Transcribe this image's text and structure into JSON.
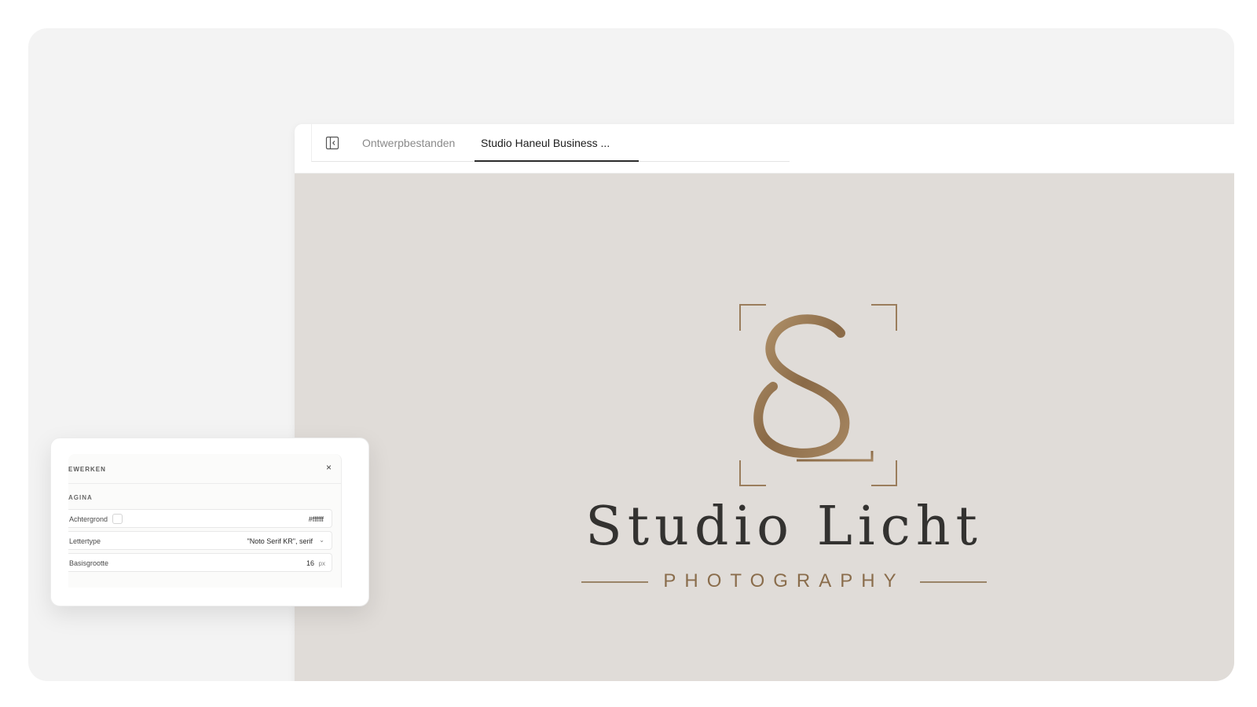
{
  "tabs": {
    "files_label": "Ontwerpbestanden",
    "active_label": "Studio Haneul Business ..."
  },
  "icons": {
    "sidebar_toggle": "sidebar-toggle-icon",
    "close": "close-icon",
    "chevron": "chevron-down-icon"
  },
  "logo": {
    "monogram": "SL",
    "name": "Studio Licht",
    "tagline": "PHOTOGRAPHY",
    "text_color": "#333230",
    "accent_color": "#8a6d4c"
  },
  "canvas": {
    "background_color": "#e0dcd8"
  },
  "panel": {
    "title": "EWERKEN",
    "close_label": "×",
    "section_label": "AGINA",
    "background": {
      "label": "Achtergrond",
      "value": "#ffffff"
    },
    "font": {
      "label": "Lettertype",
      "value": "\"Noto Serif KR\", serif"
    },
    "base_size": {
      "label": "Basisgrootte",
      "value": "16",
      "unit": "px"
    }
  }
}
